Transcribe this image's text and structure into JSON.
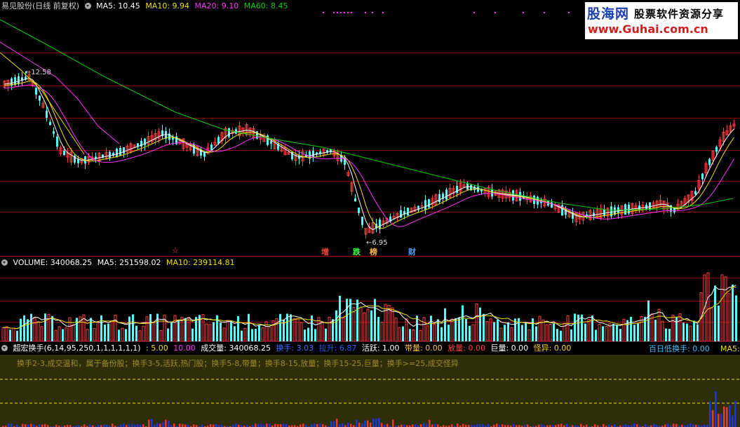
{
  "price_panel": {
    "title": "易见股份(日线 前复权)",
    "ma5_label": "MA5: 10.45",
    "ma10_label": "MA10: 9.94",
    "ma20_label": "MA20: 9.10",
    "ma60_label": "MA60: 8.45",
    "high_marker": "12.58",
    "low_marker": "6.95",
    "events": [
      "☆",
      "增",
      "跌",
      "榜",
      "财"
    ],
    "colors": {
      "ma5": "#ffffff",
      "ma10": "#f0e000",
      "ma20": "#ff30ff",
      "ma60": "#00d000",
      "up": "#ff4040",
      "down": "#54ffff",
      "grid": "#8b0000"
    }
  },
  "volume_panel": {
    "volume_label": "VOLUME: 340068.25",
    "ma5_label": "MA5: 251598.02",
    "ma10_label": "MA10: 239114.81"
  },
  "turnover_panel": {
    "indicator_name": "超宏换手(6,14,95,250,1,1,1,1,1,1)",
    "v1": ": 5.00",
    "v2": "10.00",
    "volume": "成交量: 340068.25",
    "turnover": "换手: 3.03",
    "pull": "拉升: 6.87",
    "active": "活跃: 1.00",
    "band": "带量: 0.00",
    "expand": "放量: 0.00",
    "huge": "巨量: 0.00",
    "odd": "怪异: 0.00",
    "hundred_day": "百日低换手: 0.00",
    "ma5_cut": "MA5:",
    "note": "换手2-3,成交温和，属于备份股；换手3-5,活跃,热门股；换手5-8,带量；换手8-15,放量；换手15-25,巨量；换手>=25,成交怪异"
  },
  "watermark": {
    "brand": "股海网",
    "tagline": "股票软件资源分享",
    "url": "www.Guhai.com.cn"
  },
  "chart_data": {
    "type": "candlestick",
    "price_range": [
      6.5,
      14.5
    ],
    "moving_averages": [
      "MA5",
      "MA10",
      "MA20",
      "MA60"
    ],
    "high": 12.58,
    "low": 6.95,
    "last_ma": {
      "MA5": 10.45,
      "MA10": 9.94,
      "MA20": 9.1,
      "MA60": 8.45
    },
    "volume": 340068.25,
    "volume_ma5": 251598.02,
    "volume_ma10": 239114.81
  }
}
